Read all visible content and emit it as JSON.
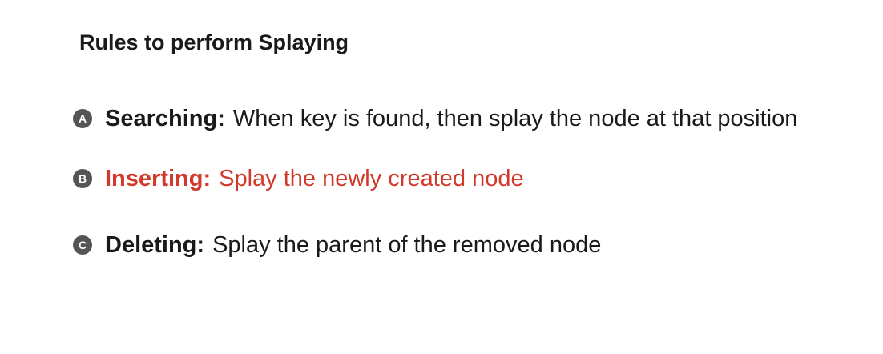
{
  "title": "Rules to perform Splaying",
  "rules": [
    {
      "badge": "A",
      "term": "Searching:",
      "description": "When key is found, then splay the node at that position"
    },
    {
      "badge": "B",
      "term": "Inserting:",
      "description": "Splay the newly created node"
    },
    {
      "badge": "C",
      "term": "Deleting:",
      "description": "Splay the parent of the removed node"
    }
  ],
  "colors": {
    "text": "#1a1a1a",
    "highlight": "#d1392b",
    "badge_bg": "#555555"
  }
}
